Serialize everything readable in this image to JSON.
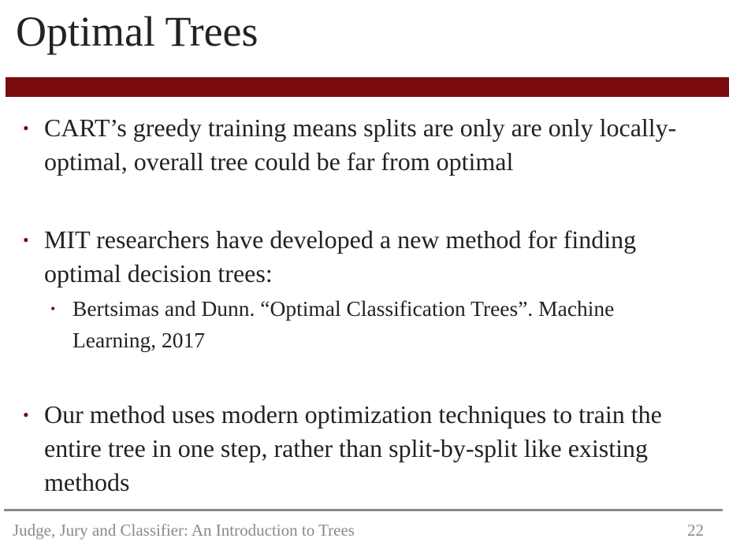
{
  "slide": {
    "title": "Optimal Trees",
    "bullets": [
      {
        "text": "CART’s greedy training means splits are only are only locally-optimal, overall tree could be far from optimal"
      },
      {
        "text": "MIT researchers have developed a new method for finding optimal decision trees:",
        "sub": "Bertsimas and Dunn. “Optimal Classification Trees”. Machine Learning, 2017"
      },
      {
        "text": "Our method uses modern optimization techniques to train the entire tree in one step, rather than split-by-split like existing methods"
      }
    ],
    "bullet_symbol": "•",
    "footer": "Judge, Jury and Classifier: An Introduction to Trees",
    "page_number": "22",
    "accent_color": "#7a0b0e"
  }
}
